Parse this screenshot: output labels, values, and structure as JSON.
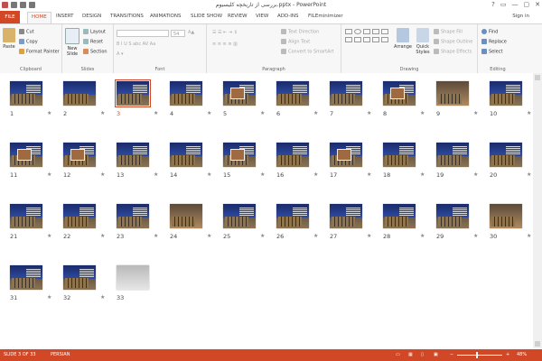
{
  "title_bar": {
    "title": "بررسی از تاریخچه کلیسیوم.pptx - PowerPoint",
    "window_controls": [
      "?",
      "▭",
      "—",
      "▢",
      "✕"
    ]
  },
  "tabs": {
    "file": "FILE",
    "items": [
      "HOME",
      "INSERT",
      "DESIGN",
      "TRANSITIONS",
      "ANIMATIONS",
      "SLIDE SHOW",
      "REVIEW",
      "VIEW",
      "ADD-INS",
      "FILEminimizer"
    ],
    "active": "HOME",
    "sign_in": "Sign in"
  },
  "ribbon": {
    "clipboard": {
      "label": "Clipboard",
      "paste": "Paste",
      "cut": "Cut",
      "copy": "Copy",
      "format_painter": "Format Painter"
    },
    "slides": {
      "label": "Slides",
      "new_slide": "New Slide",
      "layout": "Layout",
      "reset": "Reset",
      "section": "Section"
    },
    "font": {
      "label": "Font",
      "size": "54"
    },
    "paragraph": {
      "label": "Paragraph",
      "text_direction": "Text Direction",
      "align_text": "Align Text",
      "convert_smartart": "Convert to SmartArt"
    },
    "drawing": {
      "label": "Drawing",
      "arrange": "Arrange",
      "quick_styles": "Quick Styles",
      "shape_fill": "Shape Fill",
      "shape_outline": "Shape Outline",
      "shape_effects": "Shape Effects"
    },
    "editing": {
      "label": "Editing",
      "find": "Find",
      "replace": "Replace",
      "select": "Select"
    }
  },
  "slides": {
    "selected": 3,
    "star": "★",
    "items": [
      {
        "n": "1",
        "kind": "title"
      },
      {
        "n": "2",
        "kind": "plain"
      },
      {
        "n": "3",
        "kind": "text"
      },
      {
        "n": "4",
        "kind": "text"
      },
      {
        "n": "5",
        "kind": "pic"
      },
      {
        "n": "6",
        "kind": "text"
      },
      {
        "n": "7",
        "kind": "text"
      },
      {
        "n": "8",
        "kind": "pic"
      },
      {
        "n": "9",
        "kind": "alt"
      },
      {
        "n": "10",
        "kind": "text"
      },
      {
        "n": "11",
        "kind": "pic"
      },
      {
        "n": "12",
        "kind": "pic"
      },
      {
        "n": "13",
        "kind": "text"
      },
      {
        "n": "14",
        "kind": "text"
      },
      {
        "n": "15",
        "kind": "pic"
      },
      {
        "n": "16",
        "kind": "text"
      },
      {
        "n": "17",
        "kind": "pic"
      },
      {
        "n": "18",
        "kind": "text"
      },
      {
        "n": "19",
        "kind": "text"
      },
      {
        "n": "20",
        "kind": "text"
      },
      {
        "n": "21",
        "kind": "text"
      },
      {
        "n": "22",
        "kind": "text"
      },
      {
        "n": "23",
        "kind": "text"
      },
      {
        "n": "24",
        "kind": "alt"
      },
      {
        "n": "25",
        "kind": "text"
      },
      {
        "n": "26",
        "kind": "text"
      },
      {
        "n": "27",
        "kind": "text"
      },
      {
        "n": "28",
        "kind": "text"
      },
      {
        "n": "29",
        "kind": "text"
      },
      {
        "n": "30",
        "kind": "alt"
      },
      {
        "n": "31",
        "kind": "text"
      },
      {
        "n": "32",
        "kind": "text"
      },
      {
        "n": "33",
        "kind": "photo"
      }
    ]
  },
  "status": {
    "slide_info": "SLIDE 3 OF 33",
    "language": "PERSIAN",
    "zoom": "48%",
    "zoom_minus": "−",
    "zoom_plus": "+"
  }
}
